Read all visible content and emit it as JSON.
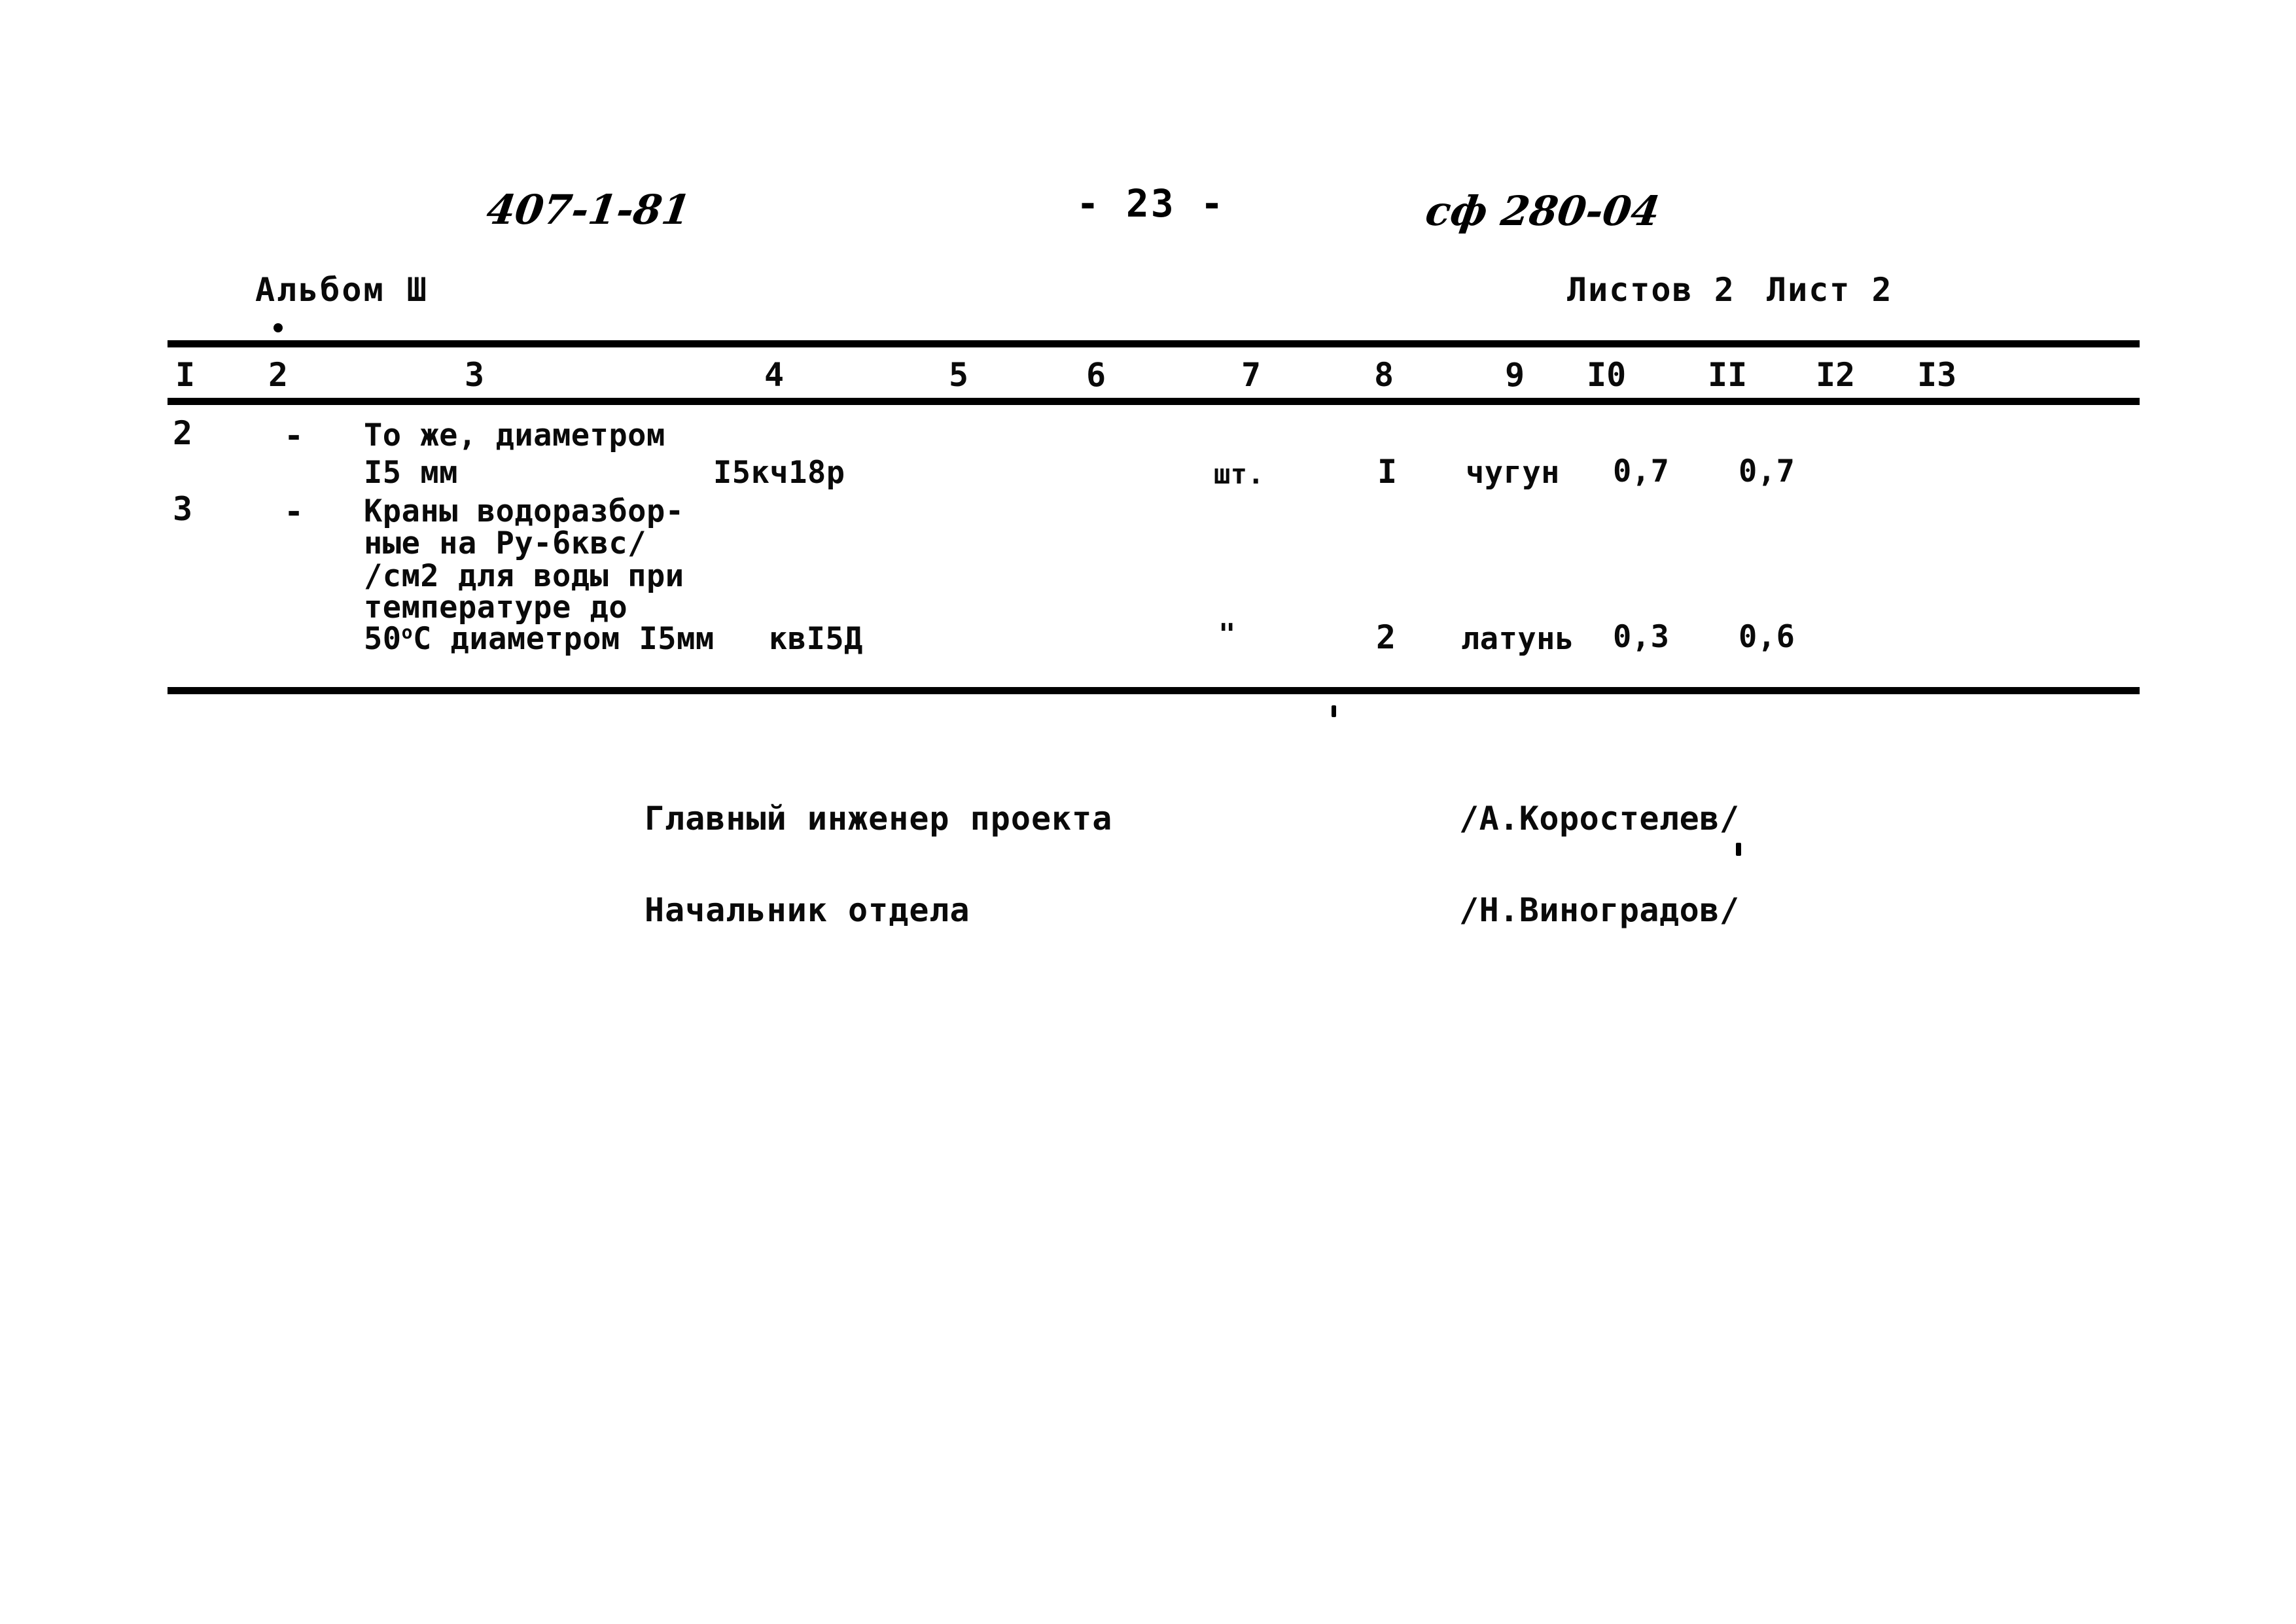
{
  "header": {
    "doc_number": "407-1-81",
    "page_number": "- 23 -",
    "archive_code": "сф 280-04",
    "album_label": "Альбом Ш",
    "sheets_total": "Листов 2",
    "sheet_current": "Лист 2"
  },
  "table": {
    "column_numbers": [
      "I",
      "2",
      "3",
      "4",
      "5",
      "6",
      "7",
      "8",
      "9",
      "I0",
      "II",
      "I2",
      "I3"
    ],
    "rows": [
      {
        "pos": "2",
        "mark": "-",
        "name_line1": "То же, диаметром",
        "name_line2": "I5 мм",
        "code": "I5кч18р",
        "unit": "шт.",
        "qty": "I",
        "material": "чугун",
        "mass_unit": "0,7",
        "mass_total": "0,7"
      },
      {
        "pos": "3",
        "mark": "-",
        "name_line1": "Краны водоразбор-",
        "name_line2": "ные на Ру-6квс/",
        "name_line3": "/см2 для воды при",
        "name_line4": "температуре до",
        "name_line5_a": "50",
        "name_line5_sup": "о",
        "name_line5_b": "С диаметром I5мм",
        "code": "квI5Д",
        "unit": "\"",
        "qty": "2",
        "material": "латунь",
        "mass_unit": "0,3",
        "mass_total": "0,6"
      }
    ]
  },
  "signatures": [
    {
      "role": "Главный инженер проекта",
      "name": "/А.Коростелев/"
    },
    {
      "role": "Начальник отдела",
      "name": "/Н.Виноградов/"
    }
  ],
  "colors": {
    "ink": "#0a0a0a",
    "paper": "#ffffff"
  }
}
